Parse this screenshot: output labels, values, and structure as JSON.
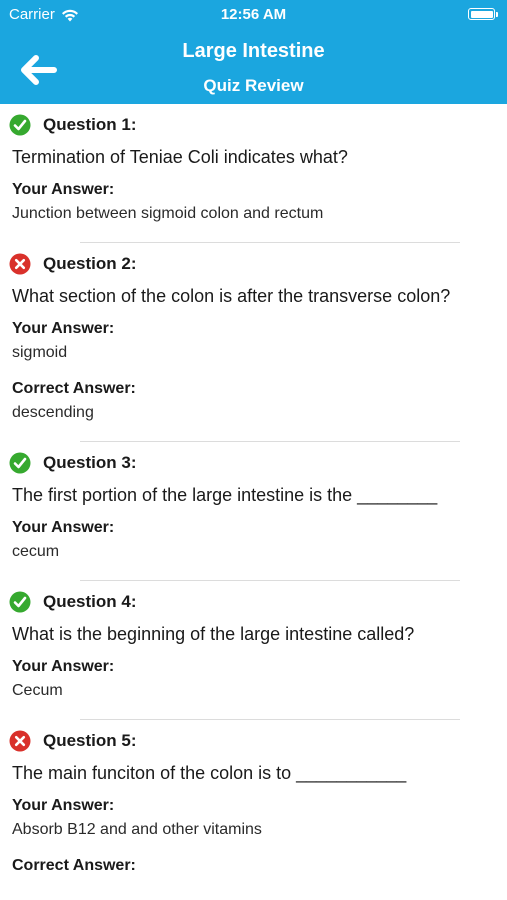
{
  "status_bar": {
    "carrier": "Carrier",
    "time": "12:56 AM"
  },
  "nav": {
    "title": "Large Intestine",
    "subtitle": "Quiz Review"
  },
  "labels": {
    "your_answer": "Your Answer:",
    "correct_answer": "Correct Answer:"
  },
  "colors": {
    "header": "#1ba6df",
    "correct": "#36a92f",
    "incorrect": "#d9312b"
  },
  "questions": [
    {
      "number": "Question 1:",
      "status": "correct",
      "text": "Termination of Teniae Coli indicates what?",
      "your_answer": "Junction between sigmoid colon and rectum"
    },
    {
      "number": "Question 2:",
      "status": "incorrect",
      "text": "What section of the colon is after the transverse colon?",
      "your_answer": "sigmoid",
      "correct_answer": "descending"
    },
    {
      "number": "Question 3:",
      "status": "correct",
      "text": "The first portion of the large intestine is the ________",
      "your_answer": "cecum"
    },
    {
      "number": "Question 4:",
      "status": "correct",
      "text": "What is the beginning of the large intestine called?",
      "your_answer": "Cecum"
    },
    {
      "number": "Question 5:",
      "status": "incorrect",
      "text": "The main funciton of the colon is to ___________",
      "your_answer": "Absorb B12 and and other vitamins",
      "correct_answer": ""
    }
  ]
}
